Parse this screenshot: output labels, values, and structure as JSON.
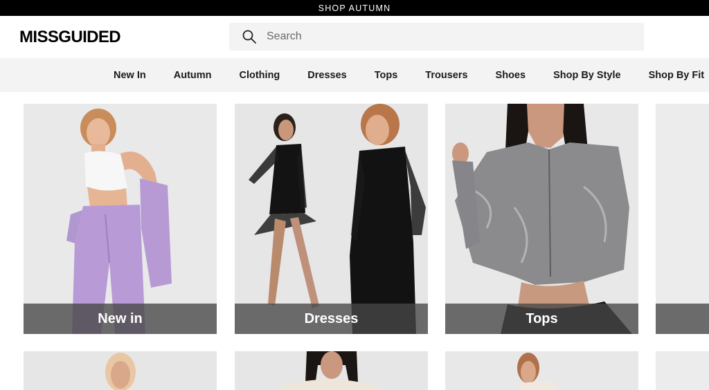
{
  "promo": {
    "text": "SHOP AUTUMN"
  },
  "header": {
    "logo": "MISSGUIDED",
    "search": {
      "placeholder": "Search",
      "value": ""
    }
  },
  "nav": {
    "items": [
      {
        "label": "New In"
      },
      {
        "label": "Autumn"
      },
      {
        "label": "Clothing"
      },
      {
        "label": "Dresses"
      },
      {
        "label": "Tops"
      },
      {
        "label": "Trousers"
      },
      {
        "label": "Shoes"
      },
      {
        "label": "Shop By Style"
      },
      {
        "label": "Shop By Fit"
      }
    ]
  },
  "categories": [
    {
      "label": "New in"
    },
    {
      "label": "Dresses"
    },
    {
      "label": "Tops"
    }
  ],
  "colors": {
    "promo_bg": "#000000",
    "nav_bg": "#f3f3f3",
    "caption_bg": "#464646"
  }
}
